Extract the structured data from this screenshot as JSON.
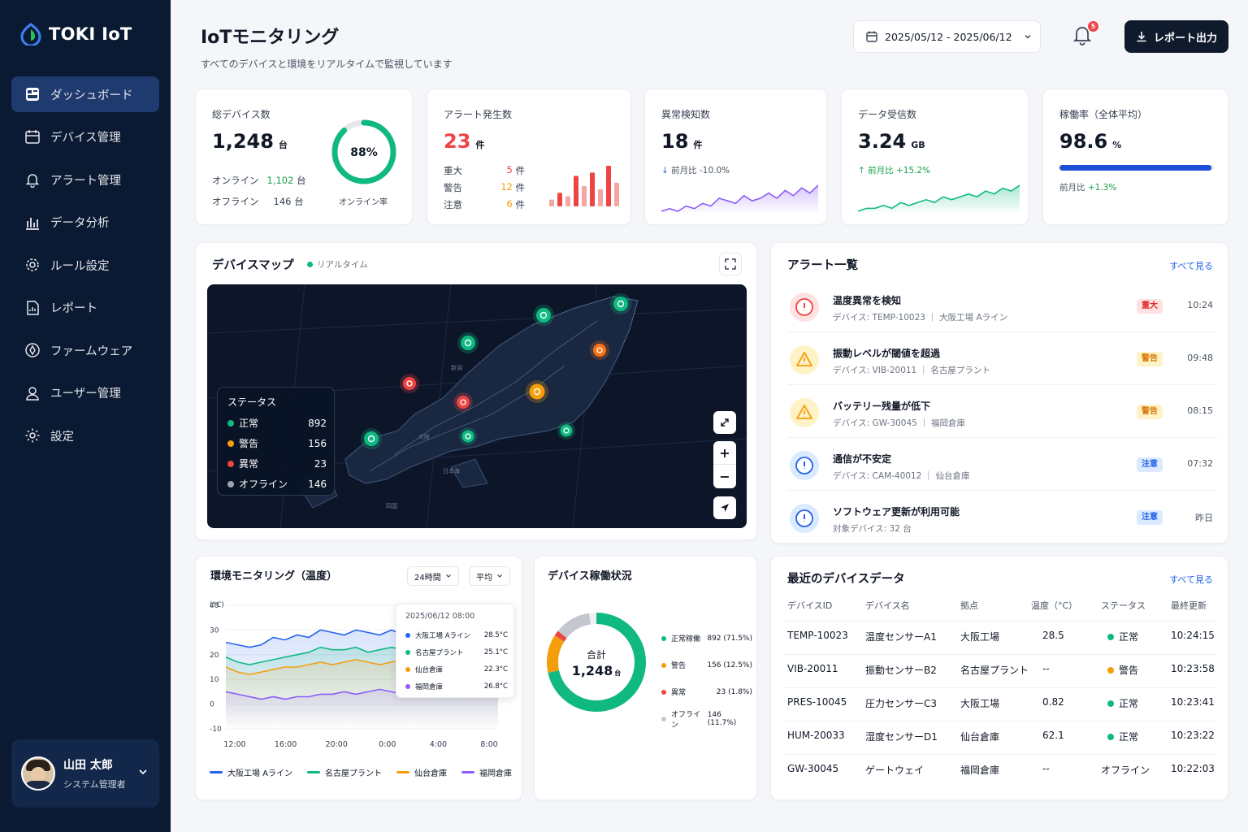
{
  "app": {
    "name": "TOKI IoT"
  },
  "nav": [
    {
      "label": "ダッシュボード",
      "icon": "dashboard-icon",
      "active": true
    },
    {
      "label": "デバイス管理",
      "icon": "device-icon"
    },
    {
      "label": "アラート管理",
      "icon": "bell-icon"
    },
    {
      "label": "データ分析",
      "icon": "chart-icon"
    },
    {
      "label": "ルール設定",
      "icon": "gear-icon"
    },
    {
      "label": "レポート",
      "icon": "report-icon"
    },
    {
      "label": "ファームウェア",
      "icon": "firmware-icon"
    },
    {
      "label": "ユーザー管理",
      "icon": "user-icon"
    },
    {
      "label": "設定",
      "icon": "settings-icon"
    }
  ],
  "user": {
    "name": "山田 太郎",
    "role": "システム管理者"
  },
  "header": {
    "title": "IoTモニタリング",
    "subtitle": "すべてのデバイスと環境をリアルタイムで監視しています",
    "date_range": "2025/05/12 - 2025/06/12",
    "notification_count": "5",
    "export_label": "レポート出力"
  },
  "kpi": {
    "devices": {
      "label": "総デバイス数",
      "value": "1,248",
      "unit": "台",
      "online_label": "オンライン",
      "online_value": "1,102",
      "offline_label": "オフライン",
      "offline_value": "146",
      "count_unit": "台",
      "rate": "88%",
      "rate_label": "オンライン率",
      "rate_fraction": 0.88
    },
    "alerts": {
      "label": "アラート発生数",
      "value": "23",
      "unit": "件",
      "rows": [
        {
          "label": "重大",
          "value": "5",
          "unit": "件"
        },
        {
          "label": "警告",
          "value": "12",
          "unit": "件"
        },
        {
          "label": "注意",
          "value": "6",
          "unit": "件"
        }
      ],
      "bars": [
        2,
        4,
        3,
        9,
        6,
        10,
        5,
        12,
        7
      ]
    },
    "anomaly": {
      "label": "異常検知数",
      "value": "18",
      "unit": "件",
      "trend": "前月比 -10.0%",
      "spark": [
        3,
        4,
        3,
        5,
        4,
        6,
        5,
        8,
        7,
        6,
        9,
        7,
        8,
        10,
        8,
        11,
        9,
        12,
        10,
        13
      ]
    },
    "data": {
      "label": "データ受信数",
      "value": "3.24",
      "unit": "GB",
      "trend": "前月比 +15.2%",
      "spark": [
        2,
        3,
        3,
        4,
        3,
        5,
        4,
        5,
        6,
        5,
        7,
        6,
        7,
        8,
        7,
        9,
        8,
        10,
        9,
        11
      ]
    },
    "uptime": {
      "label": "稼働率（全体平均）",
      "value": "98.6",
      "unit": "%",
      "trend_label": "前月比",
      "trend_value": "+1.3%",
      "fraction": 0.986
    }
  },
  "map": {
    "title": "デバイスマップ",
    "live_label": "リアルタイム",
    "legend_title": "ステータス",
    "legend": [
      {
        "label": "正常",
        "value": "892",
        "color": "#10b981"
      },
      {
        "label": "警告",
        "value": "156",
        "color": "#f59e0b"
      },
      {
        "label": "異常",
        "value": "23",
        "color": "#ef4444"
      },
      {
        "label": "オフライン",
        "value": "146",
        "color": "#9ca3af"
      }
    ]
  },
  "alerts": {
    "title": "アラート一覧",
    "view_all": "すべて見る",
    "items": [
      {
        "title": "温度異常を検知",
        "device": "デバイス: TEMP-10023 ｜ 大阪工場 Aライン",
        "badge": "重大",
        "time": "10:24",
        "level": "critical"
      },
      {
        "title": "振動レベルが閾値を超過",
        "device": "デバイス: VIB-20011 ｜ 名古屋プラント",
        "badge": "警告",
        "time": "09:48",
        "level": "warning"
      },
      {
        "title": "バッテリー残量が低下",
        "device": "デバイス: GW-30045 ｜ 福岡倉庫",
        "badge": "警告",
        "time": "08:15",
        "level": "warning"
      },
      {
        "title": "通信が不安定",
        "device": "デバイス: CAM-40012 ｜ 仙台倉庫",
        "badge": "注意",
        "time": "07:32",
        "level": "info"
      },
      {
        "title": "ソフトウェア更新が利用可能",
        "device": "対象デバイス: 32 台",
        "badge": "注意",
        "time": "昨日",
        "level": "info"
      }
    ]
  },
  "env": {
    "title": "環境モニタリング（温度）",
    "range_select": "24時間",
    "agg_select": "平均",
    "tooltip_time": "2025/06/12 08:00",
    "tooltip": [
      {
        "name": "大阪工場 Aライン",
        "value": "28.5°C"
      },
      {
        "name": "名古屋プラント",
        "value": "25.1°C"
      },
      {
        "name": "仙台倉庫",
        "value": "22.3°C"
      },
      {
        "name": "福岡倉庫",
        "value": "26.8°C"
      }
    ]
  },
  "chart_data": {
    "type": "line",
    "title": "環境モニタリング（温度）",
    "ylabel": "(°C)",
    "ylim": [
      -10,
      40
    ],
    "yticks": [
      40,
      30,
      20,
      10,
      0,
      -10
    ],
    "x": [
      "12:00",
      "16:00",
      "20:00",
      "0:00",
      "4:00",
      "8:00"
    ],
    "grid": true,
    "legend": "bottom",
    "series": [
      {
        "name": "大阪工場 Aライン",
        "color": "#2563eb",
        "values": [
          25,
          24,
          23,
          24,
          27,
          26,
          28,
          27,
          30,
          29,
          28,
          30,
          29,
          28,
          30,
          28,
          29,
          29,
          28,
          28,
          30,
          31,
          30,
          28.5
        ]
      },
      {
        "name": "名古屋プラント",
        "color": "#10b981",
        "values": [
          19,
          17,
          16,
          17,
          18,
          19,
          20,
          21,
          23,
          22,
          22,
          23,
          21,
          22,
          23,
          22,
          24,
          25,
          23,
          23,
          25,
          24,
          26,
          25.1
        ]
      },
      {
        "name": "仙台倉庫",
        "color": "#f59e0b",
        "values": [
          15,
          13,
          12,
          13,
          14,
          15,
          15,
          16,
          17,
          16,
          17,
          18,
          17,
          16,
          17,
          18,
          20,
          18,
          19,
          17,
          19,
          21,
          20,
          22.3
        ]
      },
      {
        "name": "福岡倉庫",
        "color": "#8b5cf6",
        "values": [
          5,
          4,
          3,
          2,
          3,
          2,
          3,
          3,
          4,
          4,
          5,
          4,
          5,
          6,
          5,
          4,
          6,
          5,
          6,
          7,
          6,
          7,
          8,
          7
        ]
      }
    ]
  },
  "donut": {
    "title": "デバイス稼働状況",
    "center_label": "合計",
    "center_value": "1,248",
    "center_unit": "台",
    "segments": [
      {
        "label": "正常稼働",
        "value": "892 (71.5%)",
        "color": "#10b981",
        "share": 0.715
      },
      {
        "label": "警告",
        "value": "156 (12.5%)",
        "color": "#f59e0b",
        "share": 0.125
      },
      {
        "label": "異常",
        "value": "23 (1.8%)",
        "color": "#ef4444",
        "share": 0.018
      },
      {
        "label": "オフライン",
        "value": "146 (11.7%)",
        "color": "#c4c8ce",
        "share": 0.117
      }
    ]
  },
  "recent": {
    "title": "最近のデバイスデータ",
    "view_all": "すべて見る",
    "headers": [
      "デバイスID",
      "デバイス名",
      "拠点",
      "温度（°C）",
      "ステータス",
      "最終更新"
    ],
    "rows": [
      {
        "id": "TEMP-10023",
        "name": "温度センサーA1",
        "site": "大阪工場",
        "temp": "28.5",
        "status": "正常",
        "status_color": "#10b981",
        "time": "10:24:15"
      },
      {
        "id": "VIB-20011",
        "name": "振動センサーB2",
        "site": "名古屋プラント",
        "temp": "--",
        "status": "警告",
        "status_color": "#f59e0b",
        "time": "10:23:58"
      },
      {
        "id": "PRES-10045",
        "name": "圧力センサーC3",
        "site": "大阪工場",
        "temp": "0.82",
        "status": "正常",
        "status_color": "#10b981",
        "time": "10:23:41"
      },
      {
        "id": "HUM-20033",
        "name": "湿度センサーD1",
        "site": "仙台倉庫",
        "temp": "62.1",
        "status": "正常",
        "status_color": "#10b981",
        "time": "10:23:22"
      },
      {
        "id": "GW-30045",
        "name": "ゲートウェイ",
        "site": "福岡倉庫",
        "temp": "--",
        "status": "オフライン",
        "status_color": "",
        "time": "10:22:03"
      }
    ]
  }
}
